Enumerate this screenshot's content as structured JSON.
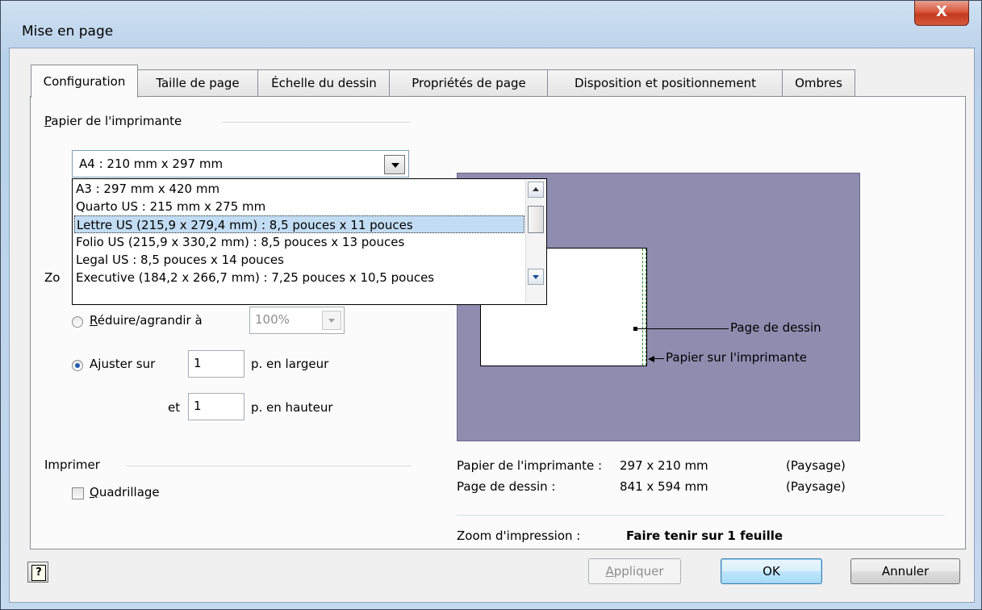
{
  "window": {
    "title": "Mise en page",
    "close_label": "X"
  },
  "tabs": [
    {
      "label": "Configuration",
      "active": true
    },
    {
      "label": "Taille de page"
    },
    {
      "label": "Échelle du dessin"
    },
    {
      "label": "Propriétés de page"
    },
    {
      "label": "Disposition et positionnement"
    },
    {
      "label": "Ombres"
    }
  ],
  "printer_paper": {
    "group_label_accel": "P",
    "group_label_rest": "apier de l'imprimante",
    "selected": "A4 :  210 mm x 297 mm",
    "options": [
      "A3 :  297 mm x 420 mm",
      "Quarto US :  215 mm x 275 mm",
      "Lettre US (215,9 x 279,4 mm) :  8,5 pouces x 11 pouces",
      "Folio US (215,9 x 330,2 mm) :  8,5 pouces x 13 pouces",
      "Legal US :  8,5 pouces x 14 pouces",
      "Executive (184,2 x 266,7 mm) :  7,25 pouces x 10,5 pouces"
    ],
    "highlighted_index": 2
  },
  "zoom": {
    "group_label_partial": "Zo",
    "reduce_label_accel": "R",
    "reduce_label_rest": "éduire/agrandir à",
    "reduce_value": "100%",
    "fit_label_pre": "A",
    "fit_label_accel": "j",
    "fit_label_rest": "uster sur",
    "width_value": "1",
    "width_suffix": "p. en largeur",
    "and_label": "et",
    "height_value": "1",
    "height_suffix": "p. en hauteur",
    "selected": "fit"
  },
  "print": {
    "group_label": "Imprimer",
    "grid_label_accel": "Q",
    "grid_label_rest": "uadrillage",
    "grid_checked": false
  },
  "preview": {
    "drawing_page_label": "Page de dessin",
    "printer_paper_label": "Papier sur l'imprimante"
  },
  "info": {
    "printer_paper_label": "Papier de l'imprimante :",
    "printer_paper_value": "297 x 210 mm",
    "printer_paper_orientation": "(Paysage)",
    "drawing_page_label": "Page de dessin :",
    "drawing_page_value": "841 x 594 mm",
    "drawing_page_orientation": "(Paysage)",
    "zoom_label": "Zoom d'impression :",
    "zoom_value": "Faire tenir sur 1 feuille"
  },
  "buttons": {
    "apply_accel": "A",
    "apply_rest": "ppliquer",
    "ok": "OK",
    "cancel": "Annuler",
    "help": "?"
  },
  "colors": {
    "preview_bg": "#8e8caf",
    "selection": "#c2dcf3"
  }
}
